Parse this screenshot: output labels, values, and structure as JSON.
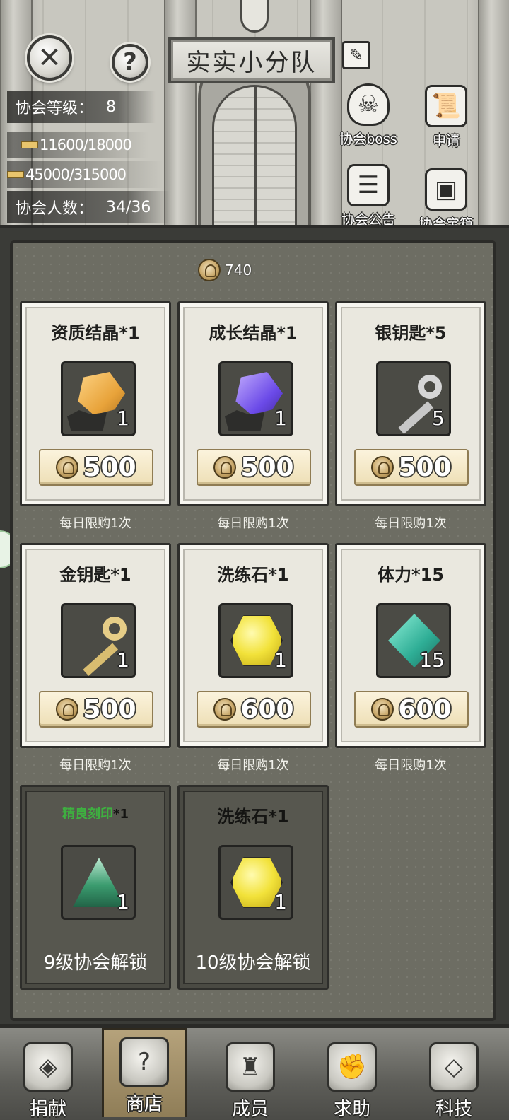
{
  "header": {
    "guild_name": "实实小分队",
    "level_label": "协会等级：",
    "level_value": "8",
    "exp_progress": "11600/18000",
    "fund_progress": "45000/315000",
    "members_label": "协会人数：",
    "members_value": "34/36",
    "icons": {
      "boss": "协会boss",
      "apply": "申请",
      "notice": "协会公告",
      "chest": "协会宝箱"
    }
  },
  "shop": {
    "coin_balance": "740",
    "items": [
      {
        "name": "资质结晶*1",
        "qty": "1",
        "price": "500",
        "limit": "每日限购1次",
        "icon": "orange-crystal-icon"
      },
      {
        "name": "成长结晶*1",
        "qty": "1",
        "price": "500",
        "limit": "每日限购1次",
        "icon": "purple-crystal-icon"
      },
      {
        "name": "银钥匙*5",
        "qty": "5",
        "price": "500",
        "limit": "每日限购1次",
        "icon": "silver-key-icon"
      },
      {
        "name": "金钥匙*1",
        "qty": "1",
        "price": "500",
        "limit": "每日限购1次",
        "icon": "gold-key-icon"
      },
      {
        "name": "洗练石*1",
        "qty": "1",
        "price": "600",
        "limit": "每日限购1次",
        "icon": "yellow-hexagon-stone-icon"
      },
      {
        "name": "体力*15",
        "qty": "15",
        "price": "600",
        "limit": "每日限购1次",
        "icon": "stamina-lightning-icon"
      }
    ],
    "locked_items": [
      {
        "name_green": "精良刻印",
        "name_suffix": "*1",
        "qty": "1",
        "unlock": "9级协会解锁",
        "icon": "green-rune-triangle-icon"
      },
      {
        "name": "洗练石*1",
        "qty": "1",
        "unlock": "10级协会解锁",
        "icon": "yellow-hexagon-stone-icon"
      }
    ]
  },
  "nav": [
    {
      "label": "捐献",
      "icon": "donate-icon"
    },
    {
      "label": "商店",
      "icon": "shop-icon",
      "active": true
    },
    {
      "label": "成员",
      "icon": "members-icon"
    },
    {
      "label": "求助",
      "icon": "help-fist-icon"
    },
    {
      "label": "科技",
      "icon": "tech-icon"
    }
  ]
}
